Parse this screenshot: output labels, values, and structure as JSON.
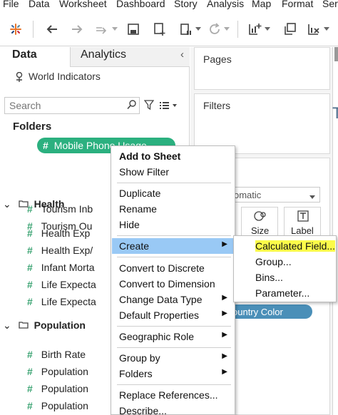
{
  "menubar": {
    "items": [
      "File",
      "Data",
      "Worksheet",
      "Dashboard",
      "Story",
      "Analysis",
      "Map",
      "Format",
      "Serv"
    ]
  },
  "toolbar": {
    "icons": [
      "tableau-logo-icon",
      "undo-icon",
      "redo-icon",
      "forward-icon",
      "save-icon",
      "new-datasource-icon",
      "pause-icon",
      "refresh-icon",
      "new-sheet-icon",
      "duplicate-sheet-icon",
      "clear-sheet-icon"
    ]
  },
  "data_pane": {
    "tab_data": "Data",
    "tab_analytics": "Analytics",
    "datasource": "World Indicators",
    "search_placeholder": "Search",
    "folders_header": "Folders",
    "top_fields": [
      "Mobile Phone Usage",
      "Tourism Inb",
      "Tourism Ou"
    ],
    "health_folder": "Health",
    "health_fields": [
      "Health Exp",
      "Health Exp/",
      "Infant Morta",
      "Life Expecta",
      "Life Expecta"
    ],
    "population_folder": "Population",
    "population_fields": [
      "Birth Rate",
      "Population",
      "Population",
      "Population"
    ]
  },
  "shelves": {
    "pages": "Pages",
    "filters": "Filters",
    "marks_type": "omatic",
    "size_label": "Size",
    "label_label": "Label",
    "country_pill": "ountry Color",
    "right_edge_title": "T"
  },
  "context_menu": {
    "add_to_sheet": "Add to Sheet",
    "show_filter": "Show Filter",
    "duplicate": "Duplicate",
    "rename": "Rename",
    "hide": "Hide",
    "create": "Create",
    "convert_discrete": "Convert to Discrete",
    "convert_dimension": "Convert to Dimension",
    "change_data_type": "Change Data Type",
    "default_properties": "Default Properties",
    "geographic_role": "Geographic Role",
    "group_by": "Group by",
    "folders": "Folders",
    "replace_references": "Replace References...",
    "describe": "Describe..."
  },
  "create_submenu": {
    "calculated_field": "Calculated Field...",
    "group": "Group...",
    "bins": "Bins...",
    "parameter": "Parameter..."
  },
  "colors": {
    "highlight_blue": "#99c9f5",
    "pill_green": "#2bb07f",
    "pill_blue": "#4a8fb8",
    "highlight_yellow": "#fbfb4a",
    "field_hash_green": "#3aa372"
  }
}
